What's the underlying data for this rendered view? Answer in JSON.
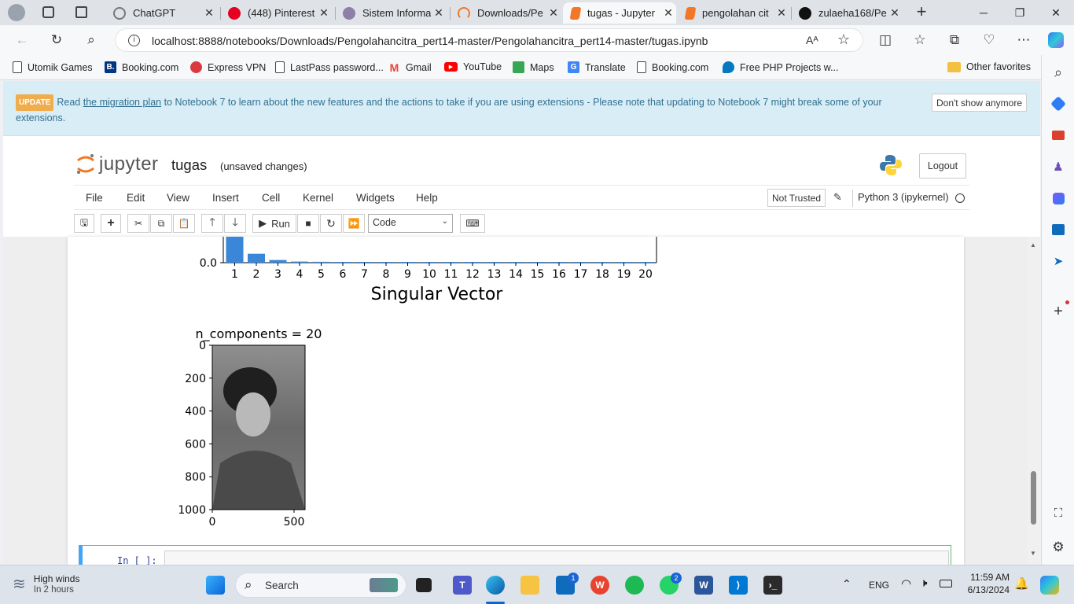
{
  "browser": {
    "tabs": [
      {
        "title": "ChatGPT",
        "color": "#8f8f8f"
      },
      {
        "title": "(448) Pinterest",
        "color": "#e60023"
      },
      {
        "title": "Sistem Informa",
        "color": "#8d7fa8"
      },
      {
        "title": "Downloads/Pe",
        "color": "#f37726"
      },
      {
        "title": "tugas - Jupyter",
        "color": "#f37726"
      },
      {
        "title": "pengolahan cit",
        "color": "#f37726"
      },
      {
        "title": "zulaeha168/Pe",
        "color": "#111111"
      }
    ],
    "new_tab": "+",
    "url": "localhost:8888/notebooks/Downloads/Pengolahancitra_pert14-master/Pengolahancitra_pert14-master/tugas.ipynb",
    "favorites": [
      {
        "label": "Utomik Games",
        "icon": "page-icon"
      },
      {
        "label": "Booking.com",
        "icon": "booking-icon"
      },
      {
        "label": "Express VPN",
        "icon": "expressvpn-icon"
      },
      {
        "label": "LastPass password...",
        "icon": "page-icon"
      },
      {
        "label": "Gmail",
        "icon": "gmail-icon"
      },
      {
        "label": "YouTube",
        "icon": "youtube-icon"
      },
      {
        "label": "Maps",
        "icon": "maps-icon"
      },
      {
        "label": "Translate",
        "icon": "translate-icon"
      },
      {
        "label": "Booking.com",
        "icon": "page-icon"
      },
      {
        "label": "Free PHP Projects w...",
        "icon": "drupal-icon"
      }
    ],
    "other_favorites": "Other favorites"
  },
  "banner": {
    "badge": "UPDATE",
    "pre": "Read ",
    "link": "the migration plan",
    "post": " to Notebook 7 to learn about the new features and the actions to take if you are using extensions - Please note that updating to Notebook 7 might break some of your extensions.",
    "dismiss": "Don't show anymore"
  },
  "jupyter": {
    "logo_text": "jupyter",
    "notebook_name": "tugas",
    "status": "(unsaved changes)",
    "logout": "Logout",
    "menus": [
      "File",
      "Edit",
      "View",
      "Insert",
      "Cell",
      "Kernel",
      "Widgets",
      "Help"
    ],
    "trust": "Not Trusted",
    "kernel": "Python 3 (ipykernel)",
    "run_label": "Run",
    "cell_type": "Code",
    "next_prompt": "In [ ]:"
  },
  "chart_data": [
    {
      "type": "bar",
      "xlabel": "Singular Vector",
      "categories": [
        "1",
        "2",
        "3",
        "4",
        "5",
        "6",
        "7",
        "8",
        "9",
        "10",
        "11",
        "12",
        "13",
        "14",
        "15",
        "16",
        "17",
        "18",
        "19",
        "20"
      ],
      "values": [
        0.12,
        0.04,
        0.012,
        0.005,
        0.004,
        0.002,
        0.0015,
        0.001,
        0.001,
        0.001,
        0.0008,
        0.0008,
        0.0008,
        0.0005,
        0.0004,
        0.0003,
        0.0003,
        0.0002,
        0.0002,
        0.0002
      ],
      "ytick_visible": "0.0",
      "color": "#3a87d9"
    },
    {
      "type": "image",
      "title": "n_components = 20",
      "yticks": [
        "0",
        "200",
        "400",
        "600",
        "800",
        "1000"
      ],
      "xticks": [
        "0",
        "500"
      ]
    }
  ],
  "taskbar": {
    "weather_title": "High winds",
    "weather_sub": "In 2 hours",
    "search": "Search",
    "lang": "ENG",
    "time": "11:59 AM",
    "date": "6/13/2024",
    "badges": {
      "mail": "1",
      "whatsapp": "2"
    }
  }
}
